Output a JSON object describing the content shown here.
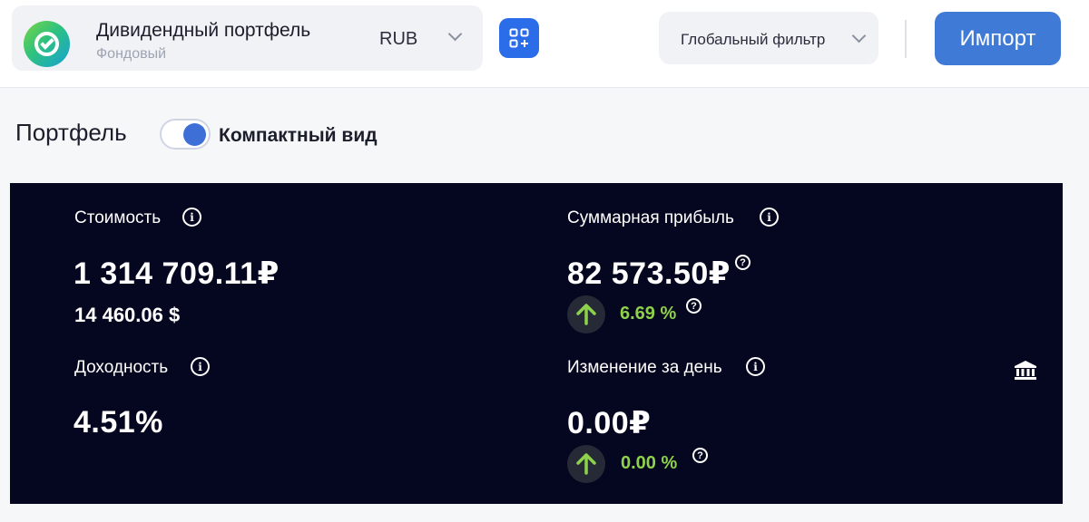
{
  "header": {
    "portfolio_name": "Дивидендный портфель",
    "portfolio_type": "Фондовый",
    "currency": "RUB",
    "filter_label": "Глобальный фильтр",
    "import_label": "Импорт"
  },
  "portfolio": {
    "title": "Портфель",
    "compact_view_label": "Компактный вид",
    "compact_view_on": true
  },
  "metrics": {
    "value_label": "Стоимость",
    "value_rub": "1 314 709.11₽",
    "value_usd": "14 460.06 $",
    "profit_label": "Суммарная прибыль",
    "profit_value": "82 573.50₽",
    "profit_percent": "6.69 %",
    "yield_label": "Доходность",
    "yield_value": "4.51%",
    "day_change_label": "Изменение за день",
    "day_change_value": "0.00₽",
    "day_change_percent": "0.00 %"
  },
  "colors": {
    "accent": "#2b6de9",
    "import_button": "#3f7ad6",
    "panel_bg": "#05061f",
    "positive": "#8ed14a"
  },
  "icons": {
    "info": "info-icon",
    "help": "question-icon",
    "trend_up": "arrow-up-icon",
    "bank": "bank-icon",
    "add_widget": "apps-add-icon",
    "dropdown": "chevron-down-icon"
  }
}
